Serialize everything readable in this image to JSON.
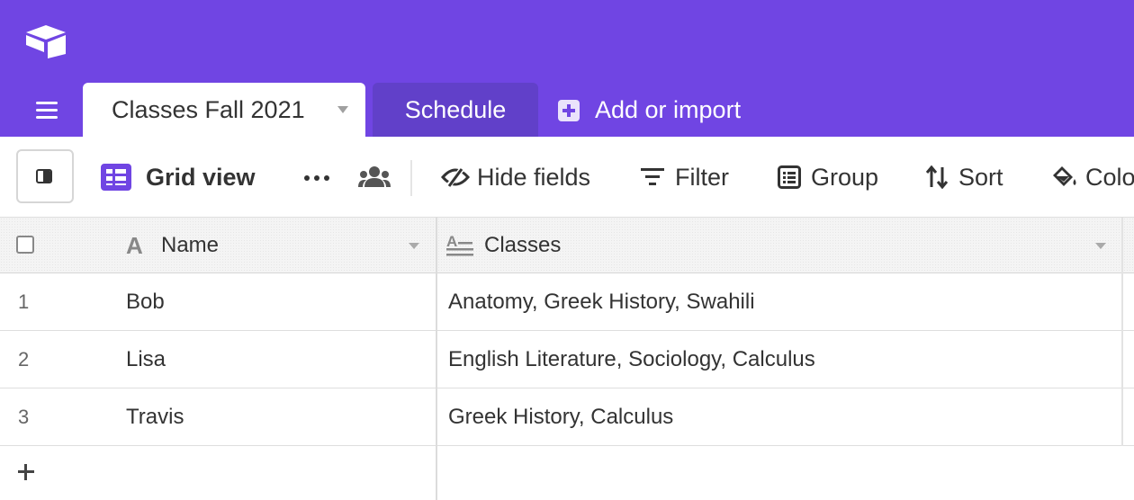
{
  "app": {
    "brand_color": "#7045E3",
    "logo_icon": "airtable-logo-icon"
  },
  "tabs": {
    "menu_icon": "hamburger-menu-icon",
    "items": [
      {
        "label": "Classes Fall 2021",
        "active": true
      },
      {
        "label": "Schedule",
        "active": false
      }
    ],
    "add_label": "Add or import"
  },
  "toolbar": {
    "view_name": "Grid view",
    "hide_fields": "Hide fields",
    "filter": "Filter",
    "group": "Group",
    "sort": "Sort",
    "color": "Colo"
  },
  "grid": {
    "columns": [
      {
        "label": "Name",
        "type_icon": "text-type-icon"
      },
      {
        "label": "Classes",
        "type_icon": "long-text-type-icon"
      }
    ],
    "rows": [
      {
        "num": "1",
        "name": "Bob",
        "classes": "Anatomy, Greek History, Swahili"
      },
      {
        "num": "2",
        "name": "Lisa",
        "classes": "English Literature, Sociology, Calculus"
      },
      {
        "num": "3",
        "name": "Travis",
        "classes": "Greek History, Calculus"
      }
    ]
  }
}
